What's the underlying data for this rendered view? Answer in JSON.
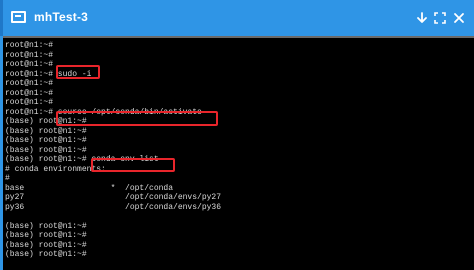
{
  "window": {
    "title": "mhTest-3",
    "title_bar_color": "#2f95e6",
    "icons": {
      "app": "window-icon",
      "minimize": "chevron-down-icon",
      "maximize": "expand-icon",
      "close": "close-icon"
    }
  },
  "terminal": {
    "background": "#000000",
    "text_color": "#d9d9d9",
    "highlight_color": "#e8252b",
    "lines": [
      "root@n1:~#",
      "root@n1:~#",
      "root@n1:~#",
      "root@n1:~# sudo -i",
      "root@n1:~#",
      "root@n1:~#",
      "root@n1:~#",
      "root@n1:~# source /opt/conda/bin/activate",
      "(base) root@n1:~#",
      "(base) root@n1:~#",
      "(base) root@n1:~#",
      "(base) root@n1:~#",
      "(base) root@n1:~# conda env list",
      "# conda environments:",
      "#",
      "base                  *  /opt/conda",
      "py27                     /opt/conda/envs/py27",
      "py36                     /opt/conda/envs/py36",
      "",
      "(base) root@n1:~#",
      "(base) root@n1:~#",
      "(base) root@n1:~#",
      "(base) root@n1:~#"
    ]
  }
}
